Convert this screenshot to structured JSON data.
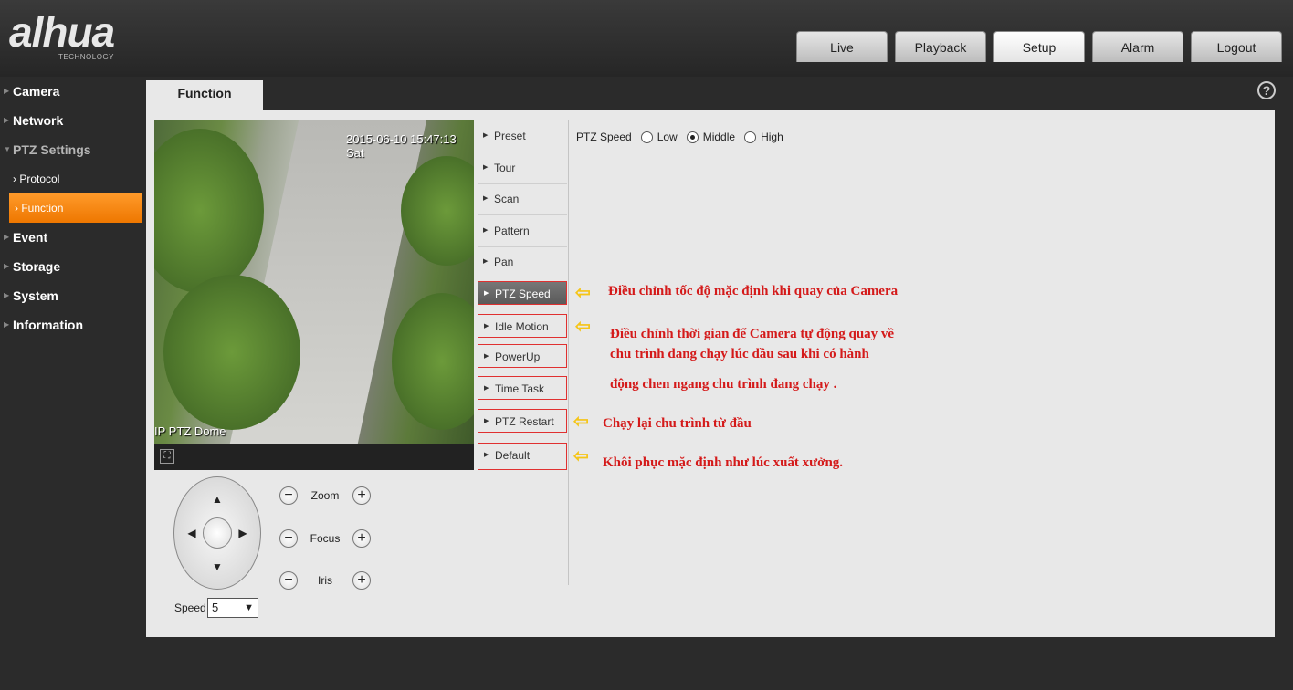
{
  "brand": {
    "logo": "alhua",
    "tagline": "TECHNOLOGY"
  },
  "tabs": [
    "Live",
    "Playback",
    "Setup",
    "Alarm",
    "Logout"
  ],
  "active_tab": "Setup",
  "sidebar": {
    "items": [
      "Camera",
      "Network",
      "PTZ Settings",
      "Event",
      "Storage",
      "System",
      "Information"
    ],
    "ptz_sub": [
      "Protocol",
      "Function"
    ]
  },
  "content": {
    "tab_title": "Function",
    "help": "?"
  },
  "video": {
    "timestamp": "2015-06-10 15:47:13 Sat",
    "camera_name": "IP PTZ Dome"
  },
  "controls": {
    "zoom": "Zoom",
    "focus": "Focus",
    "iris": "Iris",
    "speed_label": "Speed",
    "speed_value": "5"
  },
  "function_menu": [
    "Preset",
    "Tour",
    "Scan",
    "Pattern",
    "Pan",
    "PTZ Speed",
    "Idle Motion",
    "PowerUp",
    "Time Task",
    "PTZ Restart",
    "Default"
  ],
  "ptz_speed": {
    "label": "PTZ Speed",
    "options": [
      "Low",
      "Middle",
      "High"
    ],
    "selected": "Middle"
  },
  "annotations": {
    "speed": "Điều chỉnh tốc độ mặc định khi quay của Camera",
    "idle_1": "Điều chỉnh thời gian để Camera tự động quay về",
    "idle_2": "chu trình đang chạy lúc đầu sau khi có hành",
    "idle_3": "động chen ngang chu trình đang chạy .",
    "restart": "Chạy lại chu trình từ đầu",
    "default": "Khôi phục mặc định như lúc xuất xưởng."
  },
  "colors": {
    "accent": "#ee7700",
    "annotation": "#d41a1a",
    "arrow": "#f5c518"
  }
}
